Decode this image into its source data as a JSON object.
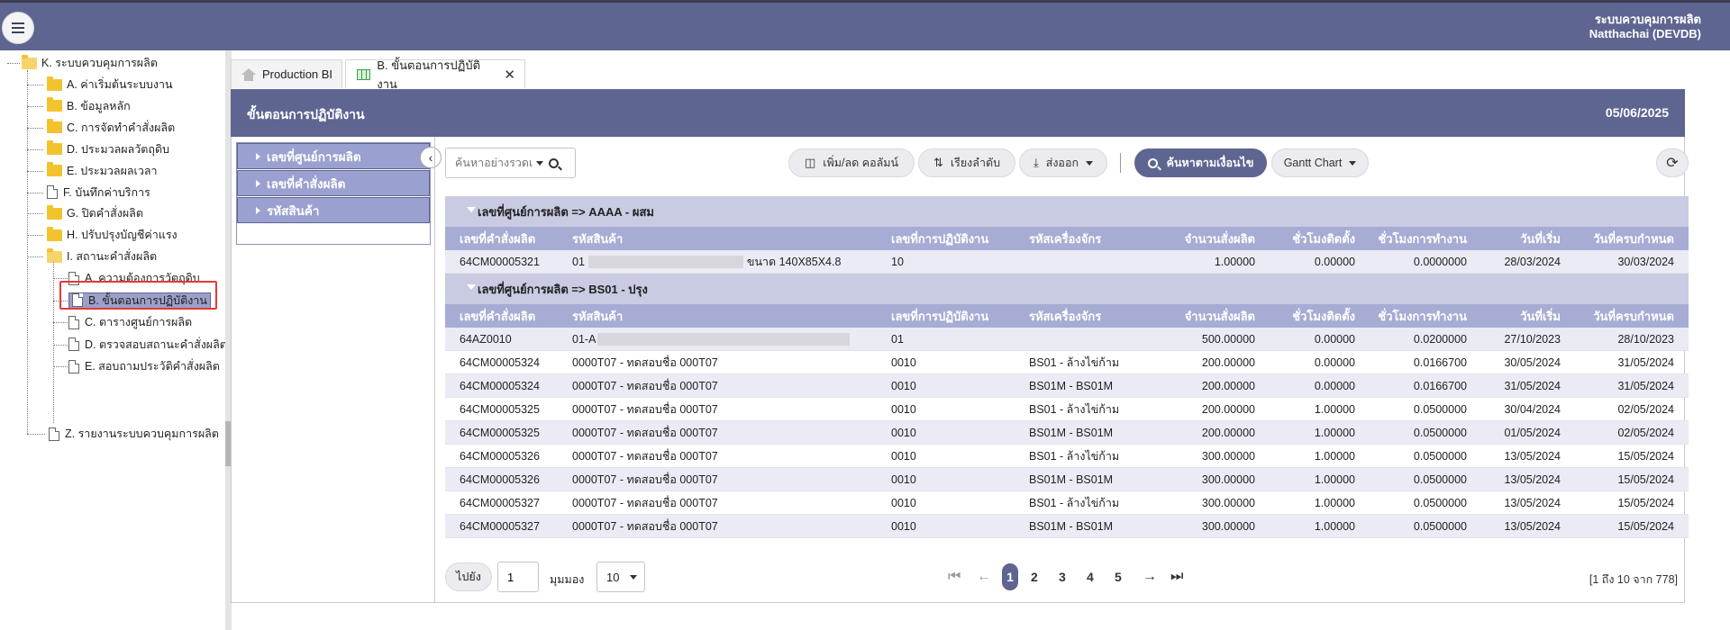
{
  "header": {
    "app_name": "ระบบควบคุมการผลิต",
    "user": "Natthachai (DEVDB)"
  },
  "sidebar": {
    "root": "K. ระบบควบคุมการผลิต",
    "items": [
      {
        "label": "A. ค่าเริ่มต้นระบบงาน",
        "type": "folder"
      },
      {
        "label": "B. ข้อมูลหลัก",
        "type": "folder"
      },
      {
        "label": "C. การจัดทำคำสั่งผลิต",
        "type": "folder"
      },
      {
        "label": "D. ประมวลผลวัตถุดิบ",
        "type": "folder"
      },
      {
        "label": "E. ประมวลผลเวลา",
        "type": "folder"
      },
      {
        "label": "F. บันทึกค่าบริการ",
        "type": "file"
      },
      {
        "label": "G. ปิดคำสั่งผลิต",
        "type": "folder"
      },
      {
        "label": "H. ปรับปรุงบัญชีค่าแรง",
        "type": "folder"
      },
      {
        "label": "I. สถานะคำสั่งผลิต",
        "type": "folder-open"
      }
    ],
    "sub_items": [
      {
        "label": "A. ความต้องการวัตถุดิบ"
      },
      {
        "label": "B. ขั้นตอนการปฏิบัติงาน",
        "selected": true
      },
      {
        "label": "C. ตารางศูนย์การผลิต"
      },
      {
        "label": "D. ตรวจสอบสถานะคำสั่งผลิต"
      },
      {
        "label": "E. สอบถามประวัติคำสั่งผลิต"
      }
    ],
    "last_item": "Z. รายงานระบบควบคุมการผลิต"
  },
  "tabs": [
    {
      "label": "Production BI",
      "icon": "home-icon"
    },
    {
      "label": "B. ขั้นตอนการปฏิบัติงาน",
      "icon": "grid-icon",
      "active": true
    }
  ],
  "panel": {
    "title": "ขั้นตอนการปฏิบัติงาน",
    "date": "05/06/2025"
  },
  "filters": [
    "เลขที่ศูนย์การผลิต",
    "เลขที่คำสั่งผลิต",
    "รหัสสินค้า"
  ],
  "toolbar": {
    "search_placeholder": "ค้นหาอย่างรวดเ",
    "columns_label": "เพิ่ม/ลด คอลัมน์",
    "sort_label": "เรียงลำดับ",
    "export_label": "ส่งออก",
    "advanced_search_label": "ค้นหาตามเงื่อนไข",
    "gantt_label": "Gantt Chart"
  },
  "columns": [
    "เลขที่คำสั่งผลิต",
    "รหัสสินค้า",
    "เลขที่การปฏิบัติงาน",
    "รหัสเครื่องจักร",
    "จำนวนสั่งผลิต",
    "ชั่วโมงติดตั้ง",
    "ชั่วโมงการทำงาน",
    "วันที่เริ่ม",
    "วันที่ครบกำหนด"
  ],
  "groups": [
    {
      "label": "เลขที่ศูนย์การผลิต => AAAA - ผสม",
      "rows": [
        [
          "64CM00005321",
          "01",
          "10",
          "",
          "1.00000",
          "0.00000",
          "0.0000000",
          "28/03/2024",
          "30/03/2024"
        ]
      ],
      "first_row_suffix": "ขนาด 140X85X4.8"
    },
    {
      "label": "เลขที่ศูนย์การผลิต => BS01 - ปรุง",
      "rows": [
        [
          "64AZ0010",
          "01-A",
          "01",
          "",
          "500.00000",
          "0.00000",
          "0.0200000",
          "27/10/2023",
          "28/10/2023"
        ],
        [
          "64CM00005324",
          "0000T07 - ทดสอบชื่อ 000T07",
          "0010",
          "BS01 - ล้างไข่ก้าม",
          "200.00000",
          "0.00000",
          "0.0166700",
          "30/05/2024",
          "31/05/2024"
        ],
        [
          "64CM00005324",
          "0000T07 - ทดสอบชื่อ 000T07",
          "0010",
          "BS01M - BS01M",
          "200.00000",
          "0.00000",
          "0.0166700",
          "31/05/2024",
          "31/05/2024"
        ],
        [
          "64CM00005325",
          "0000T07 - ทดสอบชื่อ 000T07",
          "0010",
          "BS01 - ล้างไข่ก้าม",
          "200.00000",
          "1.00000",
          "0.0500000",
          "30/04/2024",
          "02/05/2024"
        ],
        [
          "64CM00005325",
          "0000T07 - ทดสอบชื่อ 000T07",
          "0010",
          "BS01M - BS01M",
          "200.00000",
          "1.00000",
          "0.0500000",
          "01/05/2024",
          "02/05/2024"
        ],
        [
          "64CM00005326",
          "0000T07 - ทดสอบชื่อ 000T07",
          "0010",
          "BS01 - ล้างไข่ก้าม",
          "300.00000",
          "1.00000",
          "0.0500000",
          "13/05/2024",
          "15/05/2024"
        ],
        [
          "64CM00005326",
          "0000T07 - ทดสอบชื่อ 000T07",
          "0010",
          "BS01M - BS01M",
          "300.00000",
          "1.00000",
          "0.0500000",
          "13/05/2024",
          "15/05/2024"
        ],
        [
          "64CM00005327",
          "0000T07 - ทดสอบชื่อ 000T07",
          "0010",
          "BS01 - ล้างไข่ก้าม",
          "300.00000",
          "1.00000",
          "0.0500000",
          "13/05/2024",
          "15/05/2024"
        ],
        [
          "64CM00005327",
          "0000T07 - ทดสอบชื่อ 000T07",
          "0010",
          "BS01M - BS01M",
          "300.00000",
          "1.00000",
          "0.0500000",
          "13/05/2024",
          "15/05/2024"
        ]
      ]
    }
  ],
  "pager": {
    "goto_label": "ไปยัง",
    "page_value": "1",
    "view_label": "มุมมอง",
    "page_size": "10",
    "pages": [
      "1",
      "2",
      "3",
      "4",
      "5"
    ],
    "current_page": "1",
    "info": "[1 ถึง 10 จาก 778]"
  }
}
